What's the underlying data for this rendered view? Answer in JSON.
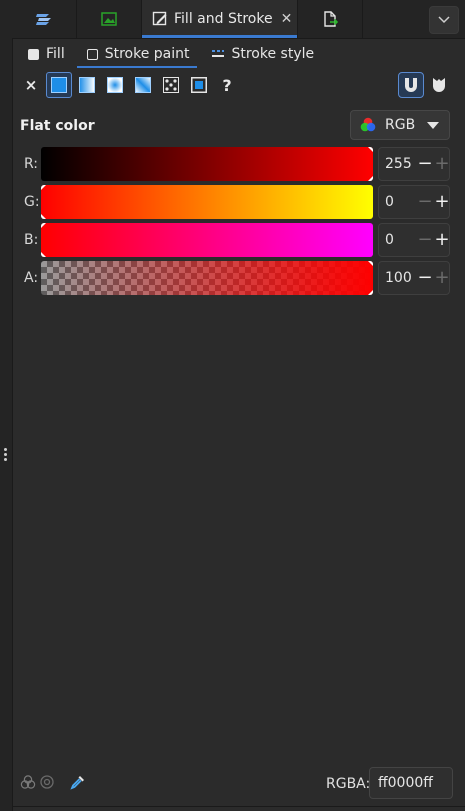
{
  "dock": {
    "active_tab_title": "Fill and Stroke",
    "active_tab_close": "✕"
  },
  "sub_tabs": [
    {
      "label": "Fill"
    },
    {
      "label": "Stroke paint"
    },
    {
      "label": "Stroke style"
    }
  ],
  "paint": {
    "none_symbol": "×",
    "unknown_symbol": "?"
  },
  "flat_color": {
    "label": "Flat color",
    "mode": "RGB"
  },
  "channels": [
    {
      "label": "R:",
      "value": "255"
    },
    {
      "label": "G:",
      "value": "0"
    },
    {
      "label": "B:",
      "value": "0"
    },
    {
      "label": "A:",
      "value": "100"
    }
  ],
  "colors": {
    "accent": "#3a7ad0",
    "current": "#ff0000"
  },
  "rgba": {
    "label": "RGBA:",
    "value": "ff0000ff"
  }
}
